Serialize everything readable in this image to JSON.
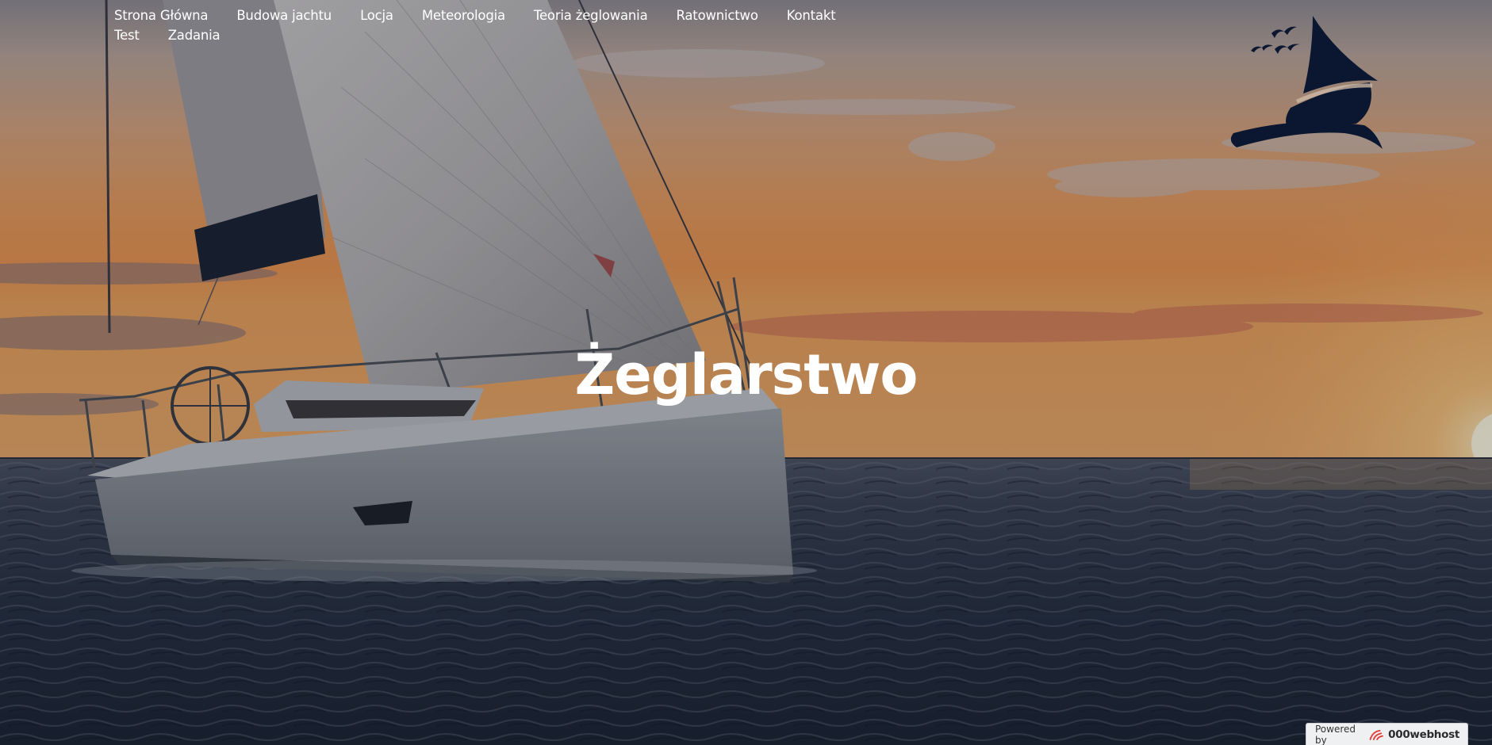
{
  "nav": {
    "items": [
      {
        "label": "Strona Główna"
      },
      {
        "label": "Budowa jachtu"
      },
      {
        "label": "Locja"
      },
      {
        "label": "Meteorologia"
      },
      {
        "label": "Teoria żeglowania"
      },
      {
        "label": "Ratownictwo"
      },
      {
        "label": "Kontakt"
      },
      {
        "label": "Test"
      },
      {
        "label": "Zadania"
      }
    ]
  },
  "hero": {
    "title": "Żeglarstwo"
  },
  "logo": {
    "icon": "sailboat-logo-icon",
    "color": "#0b1730"
  },
  "badge": {
    "powered_by": "Powered by",
    "brand": "000webhost",
    "icon": "000webhost-icon"
  },
  "colors": {
    "sky_top": "#a9a7a8",
    "sunset_orange": "#e5894a",
    "sea_dark": "#1c2636",
    "text": "#ffffff"
  }
}
